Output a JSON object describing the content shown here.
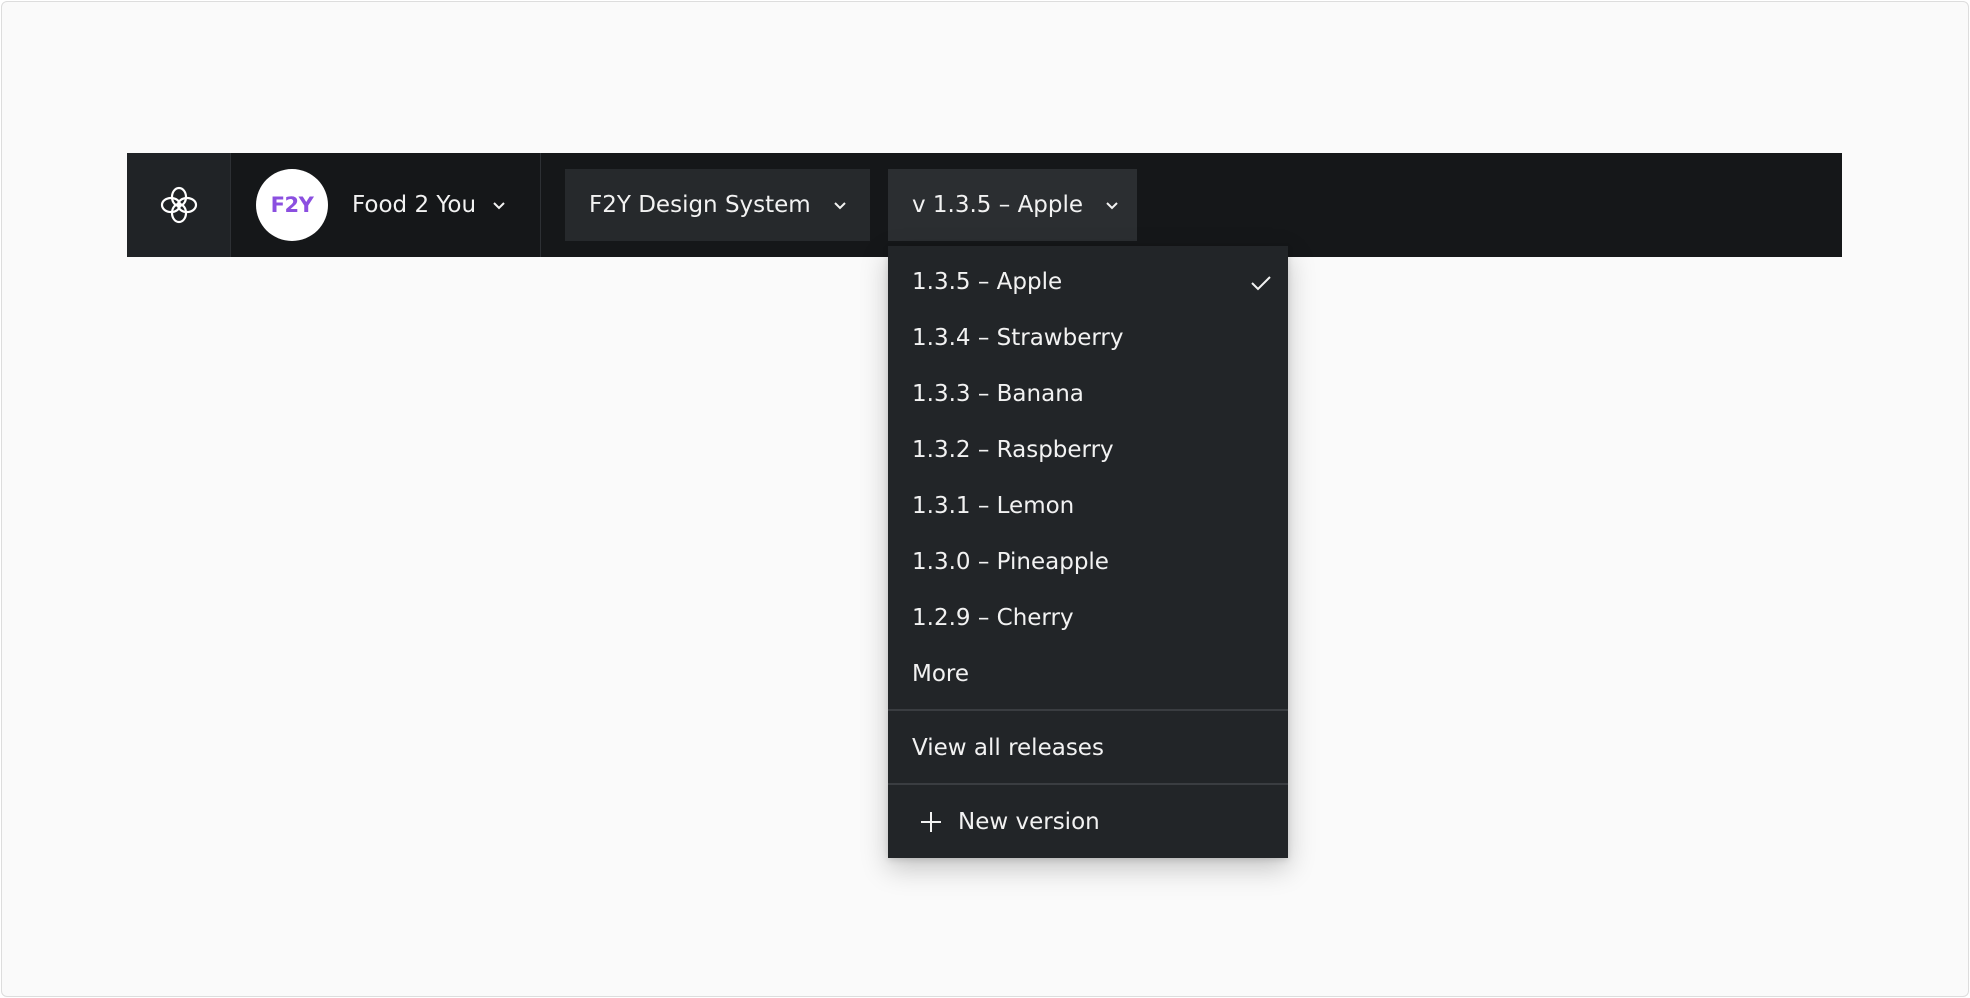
{
  "topbar": {
    "logo_icon": "flower-logo-icon",
    "org": {
      "avatar_text": "F2Y",
      "avatar_color": "#8b4fe0",
      "name": "Food 2 You"
    },
    "design_system_selector": {
      "label": "F2Y Design System"
    },
    "version_selector": {
      "label": "v 1.3.5 – Apple"
    }
  },
  "version_menu": {
    "items": [
      {
        "label": "1.3.5 – Apple",
        "selected": true
      },
      {
        "label": "1.3.4 – Strawberry"
      },
      {
        "label": "1.3.3 – Banana"
      },
      {
        "label": "1.3.2 – Raspberry"
      },
      {
        "label": "1.3.1 – Lemon"
      },
      {
        "label": "1.3.0 – Pineapple"
      },
      {
        "label": "1.2.9 – Cherry"
      }
    ],
    "more_label": "More",
    "view_all_label": "View all releases",
    "new_version_label": "New version"
  },
  "colors": {
    "topbar_bg": "#151719",
    "menu_bg": "#222528",
    "accent": "#8b4fe0"
  }
}
